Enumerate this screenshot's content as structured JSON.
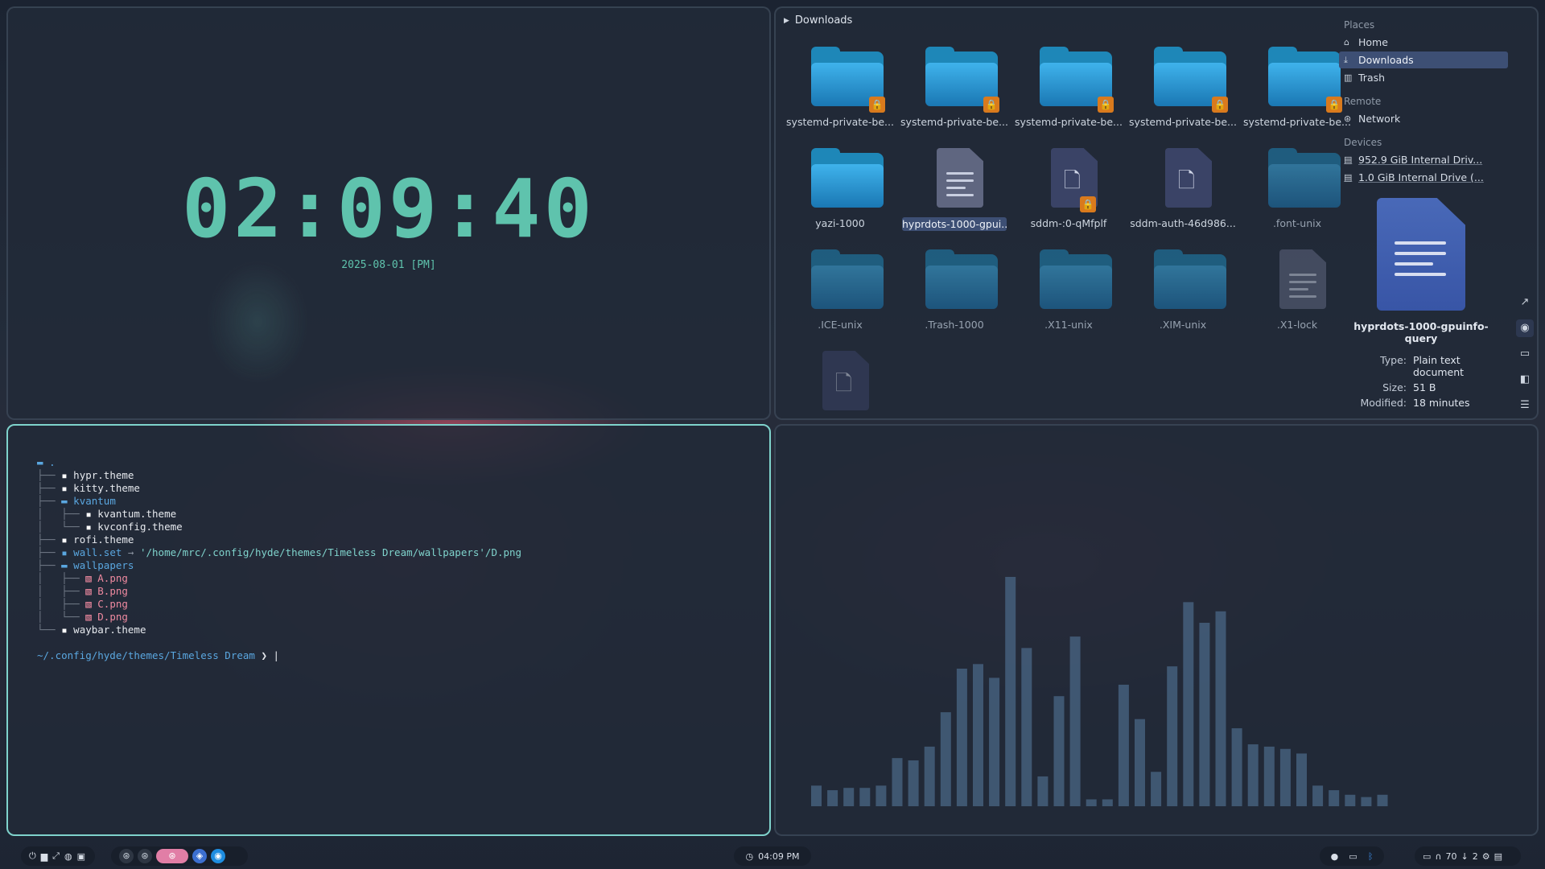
{
  "clock": {
    "time": "02:09:40",
    "date": "2025-08-01 [PM]"
  },
  "file_manager": {
    "path": "Downloads",
    "items": [
      {
        "label": "systemd-private-be...",
        "kind": "folder",
        "locked": true
      },
      {
        "label": "systemd-private-be...",
        "kind": "folder",
        "locked": true
      },
      {
        "label": "systemd-private-be...",
        "kind": "folder",
        "locked": true
      },
      {
        "label": "systemd-private-be...",
        "kind": "folder",
        "locked": true
      },
      {
        "label": "systemd-private-be...",
        "kind": "folder",
        "locked": true
      },
      {
        "label": "yazi-1000",
        "kind": "folder",
        "locked": false
      },
      {
        "label": "hyprdots-1000-gpui...",
        "kind": "text",
        "locked": false,
        "selected": true
      },
      {
        "label": "sddm-:0-qMfplf",
        "kind": "file",
        "locked": true
      },
      {
        "label": "sddm-auth-46d986...",
        "kind": "file",
        "locked": false
      },
      {
        "label": ".font-unix",
        "kind": "folder",
        "hidden": true
      },
      {
        "label": ".ICE-unix",
        "kind": "folder",
        "hidden": true
      },
      {
        "label": ".Trash-1000",
        "kind": "folder",
        "hidden": true
      },
      {
        "label": ".X11-unix",
        "kind": "folder",
        "hidden": true
      },
      {
        "label": ".XIM-unix",
        "kind": "folder",
        "hidden": true
      },
      {
        "label": ".X1-lock",
        "kind": "text",
        "hidden": true
      },
      {
        "label": "",
        "kind": "file",
        "hidden": true
      }
    ],
    "places_header": "Places",
    "places": [
      {
        "label": "Home",
        "icon": "home-icon"
      },
      {
        "label": "Downloads",
        "icon": "download-icon",
        "active": true
      },
      {
        "label": "Trash",
        "icon": "trash-icon"
      }
    ],
    "remote_header": "Remote",
    "remote": [
      {
        "label": "Network",
        "icon": "network-icon"
      }
    ],
    "devices_header": "Devices",
    "devices": [
      {
        "label": "952.9 GiB Internal Driv...",
        "icon": "drive-icon"
      },
      {
        "label": "1.0 GiB Internal Drive (...",
        "icon": "drive-icon"
      }
    ],
    "preview": {
      "name_line1": "hyprdots-1000-gpuinfo-",
      "name_line2": "query",
      "type_key": "Type:",
      "type_val1": "Plain text",
      "type_val2": "document",
      "size_key": "Size:",
      "size_val": "51 B",
      "modified_key": "Modified:",
      "modified_val": "18 minutes"
    }
  },
  "terminal": {
    "tree": [
      {
        "prefix": "",
        "icon": "dir",
        "name": ".",
        "kind": "dir"
      },
      {
        "prefix": "├── ",
        "icon": "file",
        "name": "hypr.theme",
        "kind": "file"
      },
      {
        "prefix": "├── ",
        "icon": "file",
        "name": "kitty.theme",
        "kind": "file"
      },
      {
        "prefix": "├── ",
        "icon": "dir",
        "name": "kvantum",
        "kind": "dir"
      },
      {
        "prefix": "│   ├── ",
        "icon": "file",
        "name": "kvantum.theme",
        "kind": "file"
      },
      {
        "prefix": "│   └── ",
        "icon": "file",
        "name": "kvconfig.theme",
        "kind": "file"
      },
      {
        "prefix": "├── ",
        "icon": "file",
        "name": "rofi.theme",
        "kind": "file"
      },
      {
        "prefix": "├── ",
        "icon": "file",
        "name": "wall.set",
        "kind": "link",
        "arrow": " → ",
        "target": "'/home/mrc/.config/hyde/themes/Timeless Dream/wallpapers'/D.png"
      },
      {
        "prefix": "├── ",
        "icon": "dir",
        "name": "wallpapers",
        "kind": "dir"
      },
      {
        "prefix": "│   ├── ",
        "icon": "img",
        "name": "A.png",
        "kind": "img"
      },
      {
        "prefix": "│   ├── ",
        "icon": "img",
        "name": "B.png",
        "kind": "img"
      },
      {
        "prefix": "│   ├── ",
        "icon": "img",
        "name": "C.png",
        "kind": "img"
      },
      {
        "prefix": "│   └── ",
        "icon": "img",
        "name": "D.png",
        "kind": "img"
      },
      {
        "prefix": "└── ",
        "icon": "file",
        "name": "waybar.theme",
        "kind": "file"
      }
    ],
    "prompt_path": "~/.config/hyde/themes/Timeless Dream",
    "prompt_char": "❯"
  },
  "visualizer": {
    "bar_levels": [
      0.09,
      0.07,
      0.08,
      0.08,
      0.09,
      0.21,
      0.2,
      0.26,
      0.41,
      0.6,
      0.62,
      0.56,
      1.0,
      0.69,
      0.13,
      0.48,
      0.74,
      0.03,
      0.03,
      0.53,
      0.38,
      0.15,
      0.61,
      0.89,
      0.8,
      0.85,
      0.34,
      0.27,
      0.26,
      0.25,
      0.23,
      0.09,
      0.07,
      0.05,
      0.04,
      0.05
    ],
    "bar_color": "#4a6786"
  },
  "taskbar": {
    "left_icons": [
      "power-icon",
      "files-icon",
      "expand-icon",
      "palette-icon",
      "wallpaper-icon"
    ],
    "ws_icons": [
      "steam-icon",
      "steam-icon",
      "steam-icon",
      "app-icon",
      "browser-icon"
    ],
    "clock": "04:09 PM",
    "right_status": "70",
    "right_count": "2",
    "accent": "#e17ea6"
  }
}
